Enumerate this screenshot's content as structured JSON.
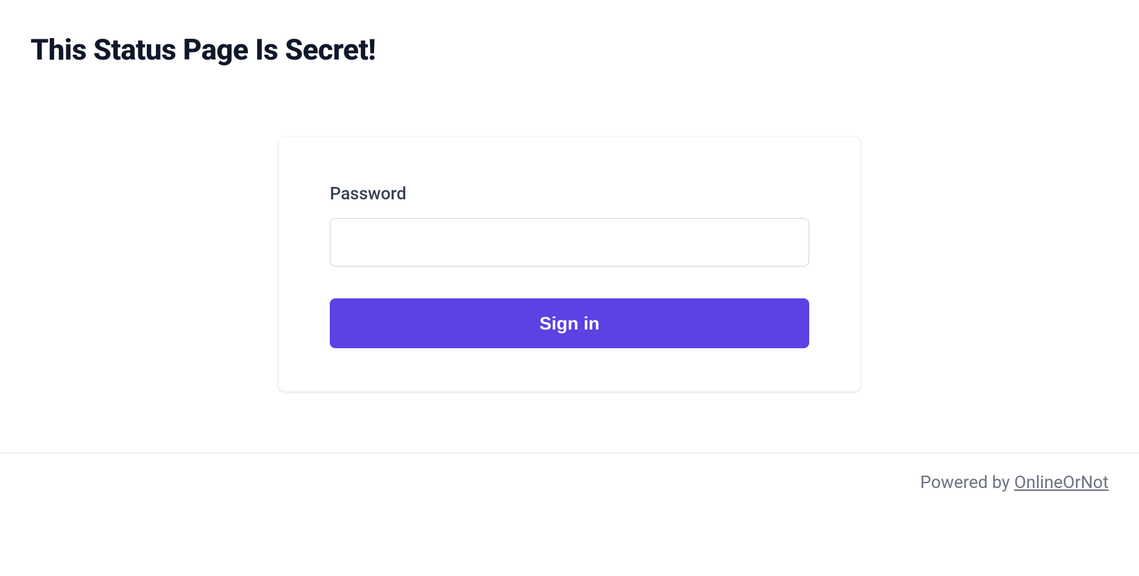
{
  "header": {
    "title": "This Status Page Is Secret!"
  },
  "form": {
    "password_label": "Password",
    "password_value": "",
    "submit_label": "Sign in"
  },
  "footer": {
    "powered_by_prefix": "Powered by ",
    "powered_by_link_text": "OnlineOrNot"
  },
  "colors": {
    "accent": "#5b42e3",
    "heading": "#0f172a",
    "label": "#374151",
    "muted": "#6b7280",
    "border": "#d1d5db"
  }
}
